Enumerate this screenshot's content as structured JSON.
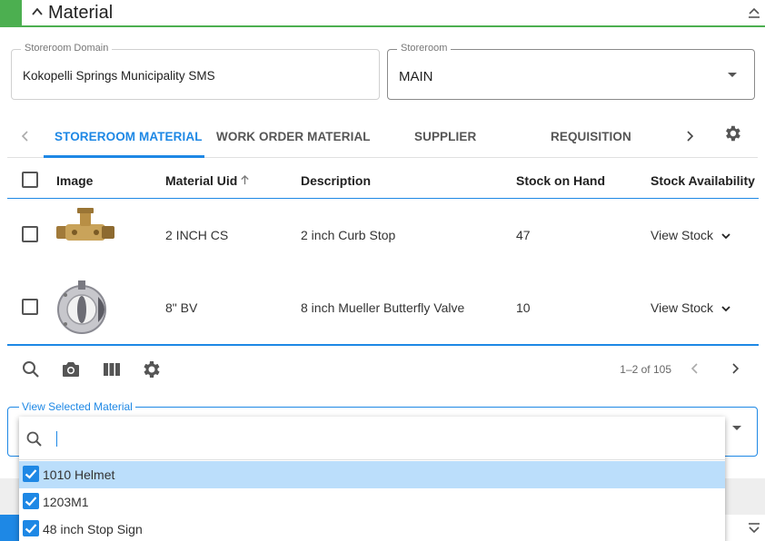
{
  "section": {
    "title": "Material"
  },
  "fields": {
    "storeroom_domain": {
      "label": "Storeroom Domain",
      "value": "Kokopelli Springs Municipality SMS"
    },
    "storeroom": {
      "label": "Storeroom",
      "value": "MAIN"
    }
  },
  "tabs": [
    {
      "label": "STOREROOM MATERIAL",
      "active": true
    },
    {
      "label": "WORK ORDER MATERIAL",
      "active": false
    },
    {
      "label": "SUPPLIER",
      "active": false
    },
    {
      "label": "REQUISITION",
      "active": false
    }
  ],
  "table": {
    "headers": {
      "image": "Image",
      "material_uid": "Material Uid",
      "description": "Description",
      "stock_on_hand": "Stock on Hand",
      "stock_availability": "Stock Availability"
    },
    "rows": [
      {
        "material_uid": "2 INCH CS",
        "description": "2 inch Curb Stop",
        "stock_on_hand": "47",
        "stock_availability": "View Stock",
        "image": "curb-stop"
      },
      {
        "material_uid": "8\" BV",
        "description": "8 inch Mueller Butterfly Valve",
        "stock_on_hand": "10",
        "stock_availability": "View Stock",
        "image": "butterfly-valve"
      }
    ]
  },
  "pager": {
    "text": "1–2 of 105"
  },
  "view_selected": {
    "label": "View Selected Material",
    "search_placeholder": "",
    "options": [
      {
        "label": "1010 Helmet",
        "checked": true,
        "highlighted": true
      },
      {
        "label": "1203M1",
        "checked": true,
        "highlighted": false
      },
      {
        "label": "48 inch Stop Sign",
        "checked": true,
        "highlighted": false
      }
    ]
  },
  "colors": {
    "accent": "#1e88e5",
    "section": "#4caf50"
  }
}
